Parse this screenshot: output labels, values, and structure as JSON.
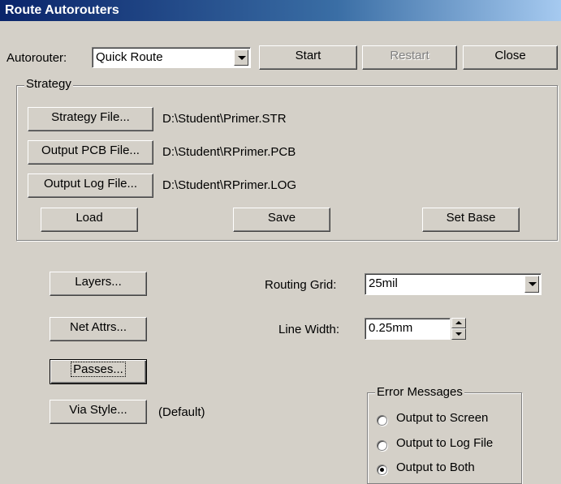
{
  "window": {
    "title": "Route Autorouters"
  },
  "top": {
    "autorouter_label": "Autorouter:",
    "autorouter_value": "Quick Route",
    "start_label": "Start",
    "restart_label": "Restart",
    "close_label": "Close"
  },
  "strategy": {
    "title": "Strategy",
    "strategy_file_button": "Strategy File...",
    "strategy_file_path": "D:\\Student\\Primer.STR",
    "output_pcb_button": "Output PCB File...",
    "output_pcb_path": "D:\\Student\\RPrimer.PCB",
    "output_log_button": "Output Log File...",
    "output_log_path": "D:\\Student\\RPrimer.LOG",
    "load_label": "Load",
    "save_label": "Save",
    "set_base_label": "Set Base"
  },
  "settings": {
    "layers_label": "Layers...",
    "net_attrs_label": "Net Attrs...",
    "passes_label": "Passes...",
    "via_style_label": "Via Style...",
    "via_style_value": "(Default)",
    "routing_grid_label": "Routing Grid:",
    "routing_grid_value": "25mil",
    "line_width_label": "Line Width:",
    "line_width_value": "0.25mm"
  },
  "error_messages": {
    "title": "Error Messages",
    "options": [
      {
        "label": "Output to Screen",
        "checked": false
      },
      {
        "label": "Output to Log File",
        "checked": false
      },
      {
        "label": "Output to Both",
        "checked": true
      }
    ]
  }
}
